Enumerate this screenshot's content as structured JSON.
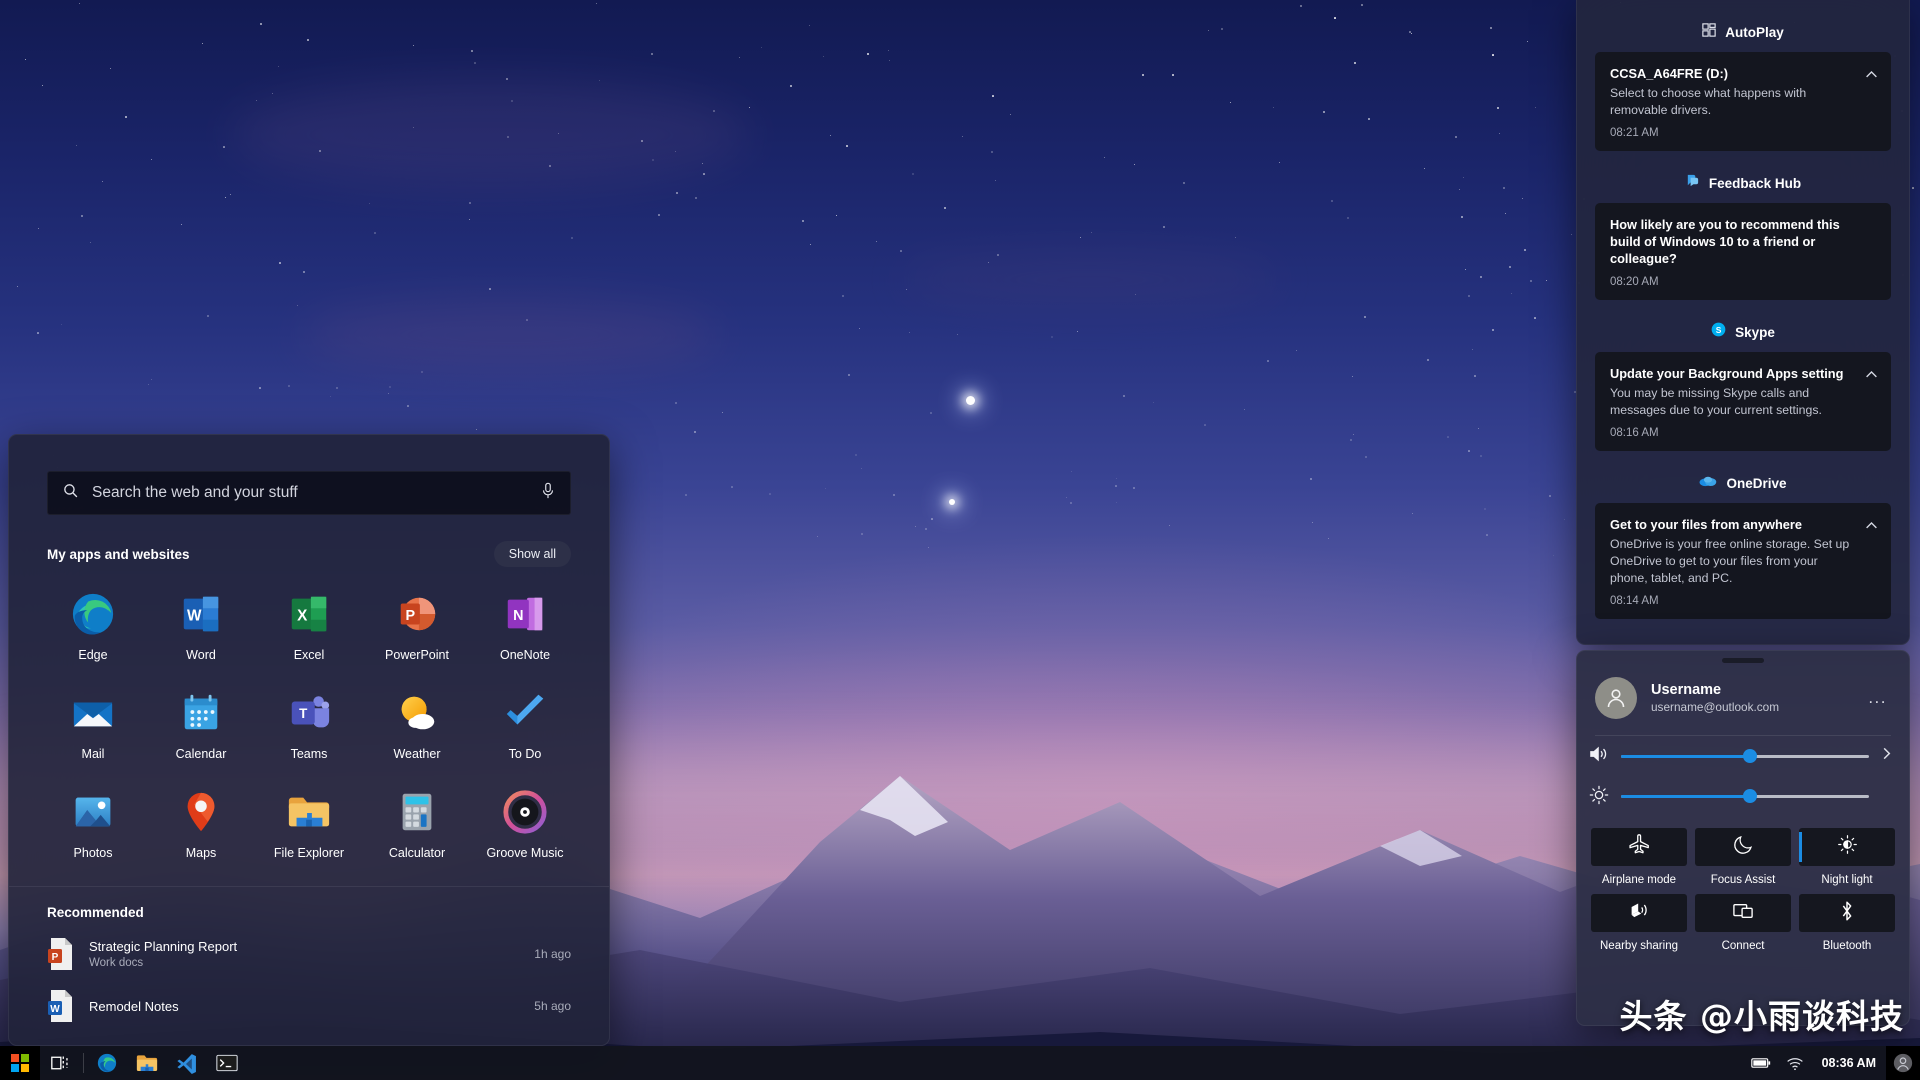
{
  "desktop": {
    "wallpaper_description": "night-sky-mountain-wallpaper"
  },
  "start_menu": {
    "search": {
      "placeholder": "Search the web and your stuff",
      "value": "",
      "search_icon": "search-icon",
      "mic_icon": "microphone-icon"
    },
    "apps_section": {
      "title": "My apps and websites",
      "show_all_label": "Show all"
    },
    "apps": [
      {
        "label": "Edge",
        "icon": "edge-icon"
      },
      {
        "label": "Word",
        "icon": "word-icon"
      },
      {
        "label": "Excel",
        "icon": "excel-icon"
      },
      {
        "label": "PowerPoint",
        "icon": "powerpoint-icon"
      },
      {
        "label": "OneNote",
        "icon": "onenote-icon"
      },
      {
        "label": "Mail",
        "icon": "mail-icon"
      },
      {
        "label": "Calendar",
        "icon": "calendar-icon"
      },
      {
        "label": "Teams",
        "icon": "teams-icon"
      },
      {
        "label": "Weather",
        "icon": "weather-icon"
      },
      {
        "label": "To Do",
        "icon": "todo-icon"
      },
      {
        "label": "Photos",
        "icon": "photos-icon"
      },
      {
        "label": "Maps",
        "icon": "maps-icon"
      },
      {
        "label": "File Explorer",
        "icon": "file-explorer-icon"
      },
      {
        "label": "Calculator",
        "icon": "calculator-icon"
      },
      {
        "label": "Groove Music",
        "icon": "groove-music-icon"
      }
    ],
    "recommended": {
      "title": "Recommended",
      "items": [
        {
          "name": "Strategic Planning Report",
          "subtitle": "Work docs",
          "time": "1h ago",
          "icon": "powerpoint-file-icon"
        },
        {
          "name": "Remodel Notes",
          "subtitle": "",
          "time": "5h ago",
          "icon": "word-file-icon"
        }
      ]
    }
  },
  "notification_panel": {
    "groups": [
      {
        "app": "AutoPlay",
        "app_icon": "autoplay-icon",
        "notifications": [
          {
            "title": "CCSA_A64FRE (D:)",
            "body": "Select to choose what happens with removable drivers.",
            "time": "08:21 AM",
            "collapse_icon": "chevron-up-icon"
          }
        ]
      },
      {
        "app": "Feedback Hub",
        "app_icon": "feedback-hub-icon",
        "notifications": [
          {
            "title": "How likely are you to recommend this build of Windows 10 to a friend or colleague?",
            "body": "",
            "time": "08:20 AM",
            "collapse_icon": ""
          }
        ]
      },
      {
        "app": "Skype",
        "app_icon": "skype-icon",
        "notifications": [
          {
            "title": "Update your Background Apps setting",
            "body": "You may be missing Skype calls and messages due to your current settings.",
            "time": "08:16 AM",
            "collapse_icon": "chevron-up-icon"
          }
        ]
      },
      {
        "app": "OneDrive",
        "app_icon": "onedrive-icon",
        "notifications": [
          {
            "title": "Get to your files from anywhere",
            "body": "OneDrive is your free online storage. Set up OneDrive to get to your files from your phone, tablet, and PC.",
            "time": "08:14 AM",
            "collapse_icon": "chevron-up-icon"
          }
        ]
      }
    ]
  },
  "quick_settings": {
    "user": {
      "name": "Username",
      "email": "username@outlook.com",
      "avatar_icon": "person-avatar-icon",
      "more_label": "..."
    },
    "sliders": [
      {
        "name": "volume",
        "icon": "speaker-icon",
        "value": 52,
        "expand_icon": "chevron-right-icon"
      },
      {
        "name": "brightness",
        "icon": "brightness-icon",
        "value": 52,
        "expand_icon": ""
      }
    ],
    "tiles": [
      {
        "label": "Airplane mode",
        "icon": "airplane-icon",
        "active": false
      },
      {
        "label": "Focus Assist",
        "icon": "moon-icon",
        "active": false
      },
      {
        "label": "Night light",
        "icon": "night-light-icon",
        "active": true
      },
      {
        "label": "Nearby sharing",
        "icon": "nearby-sharing-icon",
        "active": false
      },
      {
        "label": "Connect",
        "icon": "connect-icon",
        "active": false
      },
      {
        "label": "Bluetooth",
        "icon": "bluetooth-icon",
        "active": false
      }
    ]
  },
  "taskbar": {
    "start_icon": "windows-logo-icon",
    "items": [
      {
        "name": "task-view",
        "icon": "task-view-icon"
      },
      {
        "name": "edge",
        "icon": "edge-icon"
      },
      {
        "name": "file-explorer",
        "icon": "file-explorer-icon"
      },
      {
        "name": "vscode",
        "icon": "vscode-icon"
      },
      {
        "name": "terminal",
        "icon": "terminal-icon"
      }
    ],
    "tray": [
      {
        "name": "battery",
        "icon": "battery-icon"
      },
      {
        "name": "network",
        "icon": "wifi-icon"
      }
    ],
    "clock": "08:36 AM",
    "account_icon": "person-avatar-icon"
  },
  "watermark": {
    "text": "头条 @小雨谈科技"
  },
  "colors": {
    "accent": "#1b8ce3",
    "panel_bg": "#22263e",
    "card_bg": "#14161f",
    "taskbar_bg": "#12141e"
  }
}
